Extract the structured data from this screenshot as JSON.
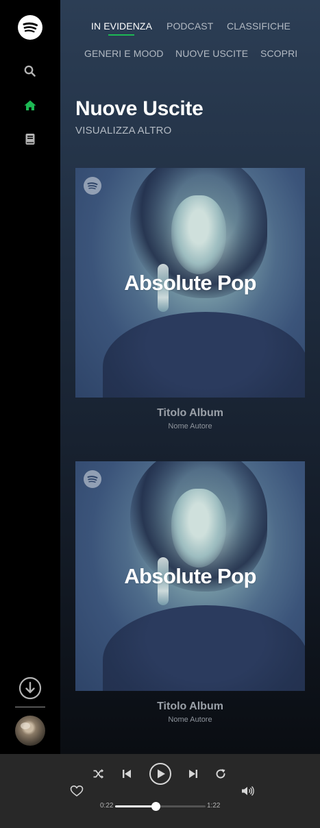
{
  "sidebar": {
    "logo_icon": "spotify-logo-icon",
    "items": [
      {
        "icon": "search-icon",
        "active": false
      },
      {
        "icon": "home-icon",
        "active": true
      },
      {
        "icon": "library-icon",
        "active": false
      }
    ],
    "download_icon": "download-icon",
    "avatar": "user-avatar"
  },
  "nav": {
    "tabs": [
      {
        "label": "IN EVIDENZA",
        "active": true
      },
      {
        "label": "PODCAST",
        "active": false
      },
      {
        "label": "CLASSIFICHE",
        "active": false
      },
      {
        "label": "GENERI E MOOD",
        "active": false
      },
      {
        "label": "NUOVE USCITE",
        "active": false
      },
      {
        "label": "SCOPRI",
        "active": false
      }
    ],
    "accent_color": "#1db954"
  },
  "section": {
    "title": "Nuove Uscite",
    "link": "VISUALIZZA ALTRO"
  },
  "albums": [
    {
      "cover_text": "Absolute Pop",
      "title": "Titolo Album",
      "author": "Nome Autore"
    },
    {
      "cover_text": "Absolute Pop",
      "title": "Titolo Album",
      "author": "Nome Autore"
    }
  ],
  "player": {
    "current_time": "0:22",
    "total_time": "1:22",
    "progress": 0.45,
    "icons": [
      "shuffle-icon",
      "previous-icon",
      "play-icon",
      "next-icon",
      "repeat-icon",
      "heart-icon",
      "volume-icon"
    ]
  }
}
